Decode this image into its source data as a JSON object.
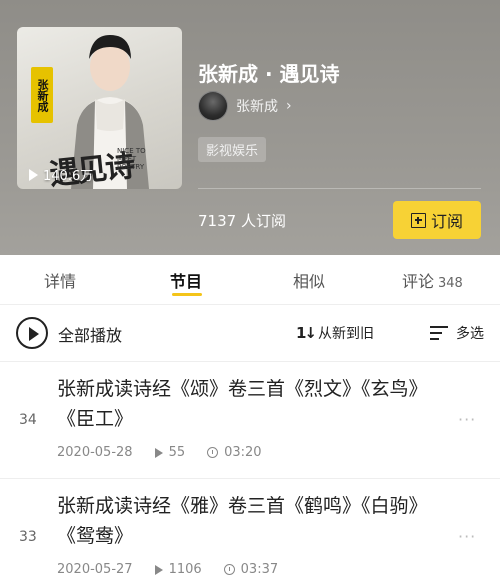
{
  "header": {
    "album_title": "张新成 · 遇见诗",
    "author_name": "张新成",
    "author_chevron": "›",
    "category_tag": "影视娱乐",
    "subscriber_count": "7137 人订阅",
    "subscribe_label": "订阅",
    "cover": {
      "play_count": "140.6万",
      "badge_text": "张新成",
      "art_title": "遇见诗",
      "art_subtitle": "NICE TO MEET POETRY"
    }
  },
  "tabs": [
    {
      "label": "详情",
      "active": false
    },
    {
      "label": "节目",
      "active": true
    },
    {
      "label": "相似",
      "active": false
    },
    {
      "label": "评论",
      "active": false,
      "count": "348"
    }
  ],
  "toolbar": {
    "play_all_label": "全部播放",
    "sort_icon": "1↓",
    "sort_label": "从新到旧",
    "multi_select_label": "多选"
  },
  "episodes": [
    {
      "number": "34",
      "title": "张新成读诗经《颂》卷三首《烈文》《玄鸟》《臣工》",
      "date": "2020-05-28",
      "plays": "55",
      "duration": "03:20"
    },
    {
      "number": "33",
      "title": "张新成读诗经《雅》卷三首《鹤鸣》《白驹》《鸳鸯》",
      "date": "2020-05-27",
      "plays": "1106",
      "duration": "03:37"
    }
  ],
  "more_icon": "···",
  "colors": {
    "accent_yellow": "#f7d235",
    "tab_underline": "#f4c419",
    "header_bg": "#9a9893"
  }
}
